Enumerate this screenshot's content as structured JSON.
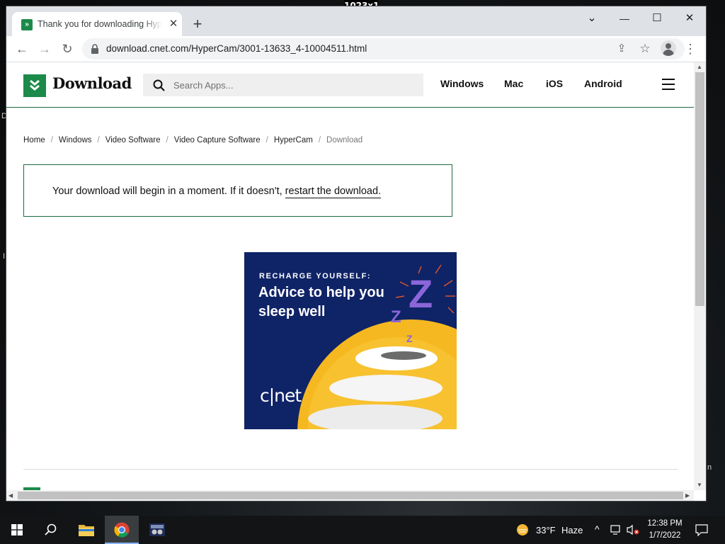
{
  "screen_label": "1023x1",
  "desktop": {
    "left_edge_letters": [
      "D",
      "I"
    ],
    "right_edge_letter": "n"
  },
  "browser": {
    "tab_title": "Thank you for downloading HyperCam",
    "tab_close": "✕",
    "new_tab": "+",
    "window_controls": {
      "dropdown": "⌄",
      "minimize": "—",
      "maximize": "☐",
      "close": "✕"
    },
    "nav": {
      "back": "←",
      "forward": "→",
      "reload": "↻"
    },
    "url": "download.cnet.com/HyperCam/3001-13633_4-10004511.html",
    "omnibox_icons": {
      "share": "⇪",
      "bookmark": "☆"
    },
    "menu": "⋮"
  },
  "site": {
    "logo_text": "Download",
    "search_placeholder": "Search Apps...",
    "nav_links": [
      "Windows",
      "Mac",
      "iOS",
      "Android"
    ]
  },
  "breadcrumb": {
    "items": [
      "Home",
      "Windows",
      "Video Software",
      "Video Capture Software",
      "HyperCam"
    ],
    "current": "Download",
    "separator": "/"
  },
  "notice": {
    "text": "Your download will begin in a moment. If it doesn't, ",
    "link": "restart the download."
  },
  "ad": {
    "eyebrow": "RECHARGE YOURSELF:",
    "headline": "Advice to help you sleep well",
    "brand": "c|net",
    "letters": {
      "big": "Z",
      "mid": "Z",
      "small": "Z"
    }
  },
  "taskbar": {
    "weather_temp": "33°F",
    "weather_desc": "Haze",
    "time": "12:38 PM",
    "date": "1/7/2022",
    "tray_up": "^"
  },
  "colors": {
    "brand_green": "#1c8a4a",
    "ad_navy": "#0f2367",
    "ad_yellow": "#f5b820",
    "ad_purple": "#8a66d9"
  }
}
